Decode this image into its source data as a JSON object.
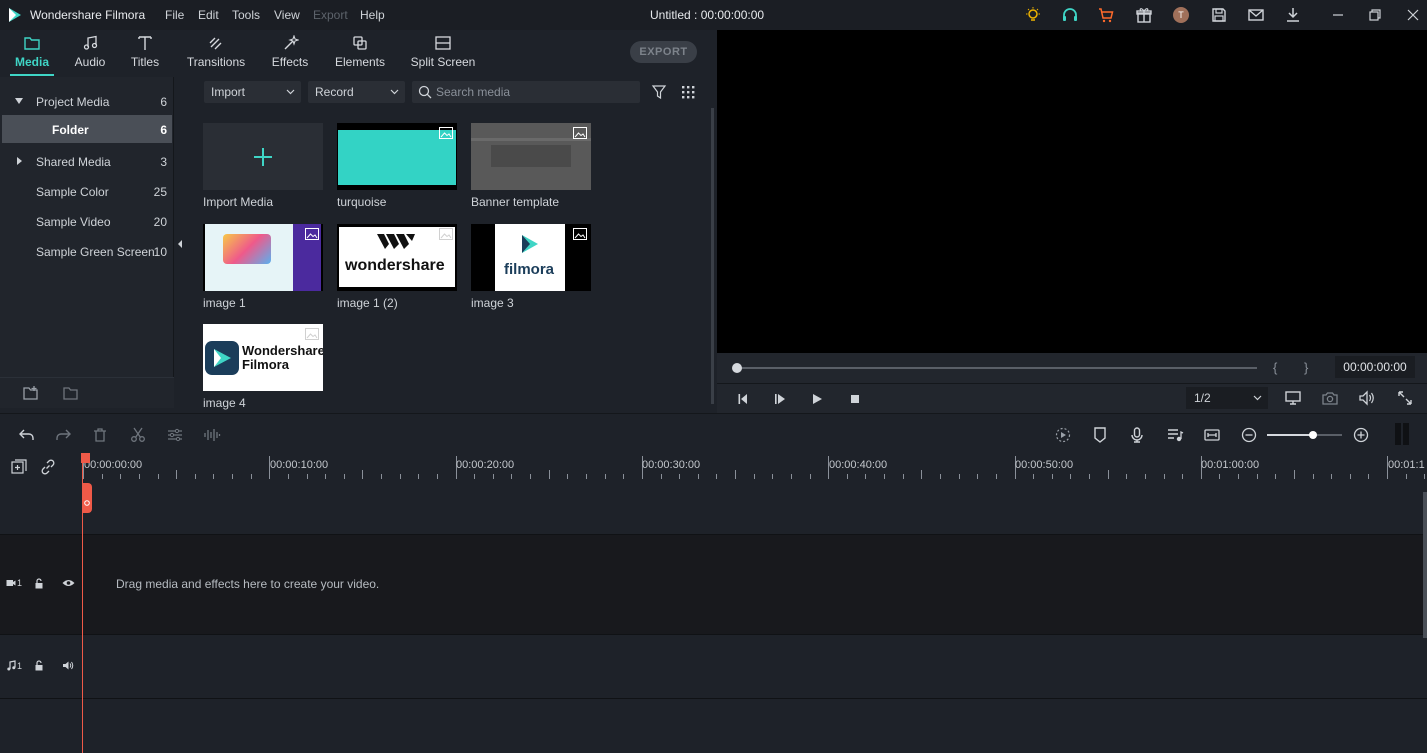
{
  "titlebar": {
    "app_name": "Wondershare Filmora",
    "menus": [
      "File",
      "Edit",
      "Tools",
      "View",
      "Export",
      "Help"
    ],
    "disabled_menus": [
      "Export"
    ],
    "document_title": "Untitled : 00:00:00:00",
    "avatar_letter": "T",
    "icons": [
      "bulb-icon",
      "headset-icon",
      "cart-icon",
      "gift-icon",
      "avatar",
      "save-icon",
      "mail-icon",
      "download-icon",
      "minimize-icon",
      "restore-icon",
      "close-icon"
    ],
    "accent_colors": {
      "bulb": "#f0b400",
      "headset": "#3fd5c6",
      "cart": "#ff6a2b"
    }
  },
  "tabs": [
    {
      "label": "Media",
      "icon": "folder-icon",
      "active": true
    },
    {
      "label": "Audio",
      "icon": "music-note-icon",
      "active": false
    },
    {
      "label": "Titles",
      "icon": "text-icon",
      "active": false
    },
    {
      "label": "Transitions",
      "icon": "transition-icon",
      "active": false
    },
    {
      "label": "Effects",
      "icon": "effects-icon",
      "active": false
    },
    {
      "label": "Elements",
      "icon": "elements-icon",
      "active": false
    },
    {
      "label": "Split Screen",
      "icon": "split-screen-icon",
      "active": false
    }
  ],
  "export_label": "EXPORT",
  "sidebar": {
    "items": [
      {
        "label": "Project Media",
        "count": "6",
        "expanded": true
      },
      {
        "label": "Folder",
        "count": "6",
        "selected": true
      },
      {
        "label": "Shared Media",
        "count": "3",
        "expanded": false
      },
      {
        "label": "Sample Color",
        "count": "25"
      },
      {
        "label": "Sample Video",
        "count": "20"
      },
      {
        "label": "Sample Green Screen",
        "count": "10"
      }
    ]
  },
  "media_toolbar": {
    "import_label": "Import",
    "record_label": "Record",
    "search_placeholder": "Search media"
  },
  "media_items": [
    {
      "name": "Import Media",
      "kind": "import"
    },
    {
      "name": "turquoise",
      "kind": "image"
    },
    {
      "name": "Banner template",
      "kind": "image"
    },
    {
      "name": "image 1",
      "kind": "image"
    },
    {
      "name": "image 1 (2)",
      "kind": "image",
      "logo_text": "wondershare"
    },
    {
      "name": "image 3",
      "kind": "image",
      "logo_text": "filmora"
    },
    {
      "name": "image 4",
      "kind": "image",
      "logo_text_line1": "Wondershare",
      "logo_text_line2": "Filmora"
    }
  ],
  "preview": {
    "timecode": "00:00:00:00",
    "ratio": "1/2",
    "mark_in": "{",
    "mark_out": "}",
    "progress": 0
  },
  "ruler_labels": [
    "00:00:00:00",
    "00:00:10:00",
    "00:00:20:00",
    "00:00:30:00",
    "00:00:40:00",
    "00:00:50:00",
    "00:01:00:00",
    "00:01:1"
  ],
  "tracks": {
    "video_label": "1",
    "audio_label": "1",
    "drop_hint": "Drag media and effects here to create your video."
  },
  "colors": {
    "accent": "#3fd5c6",
    "playhead": "#ef5a48"
  }
}
